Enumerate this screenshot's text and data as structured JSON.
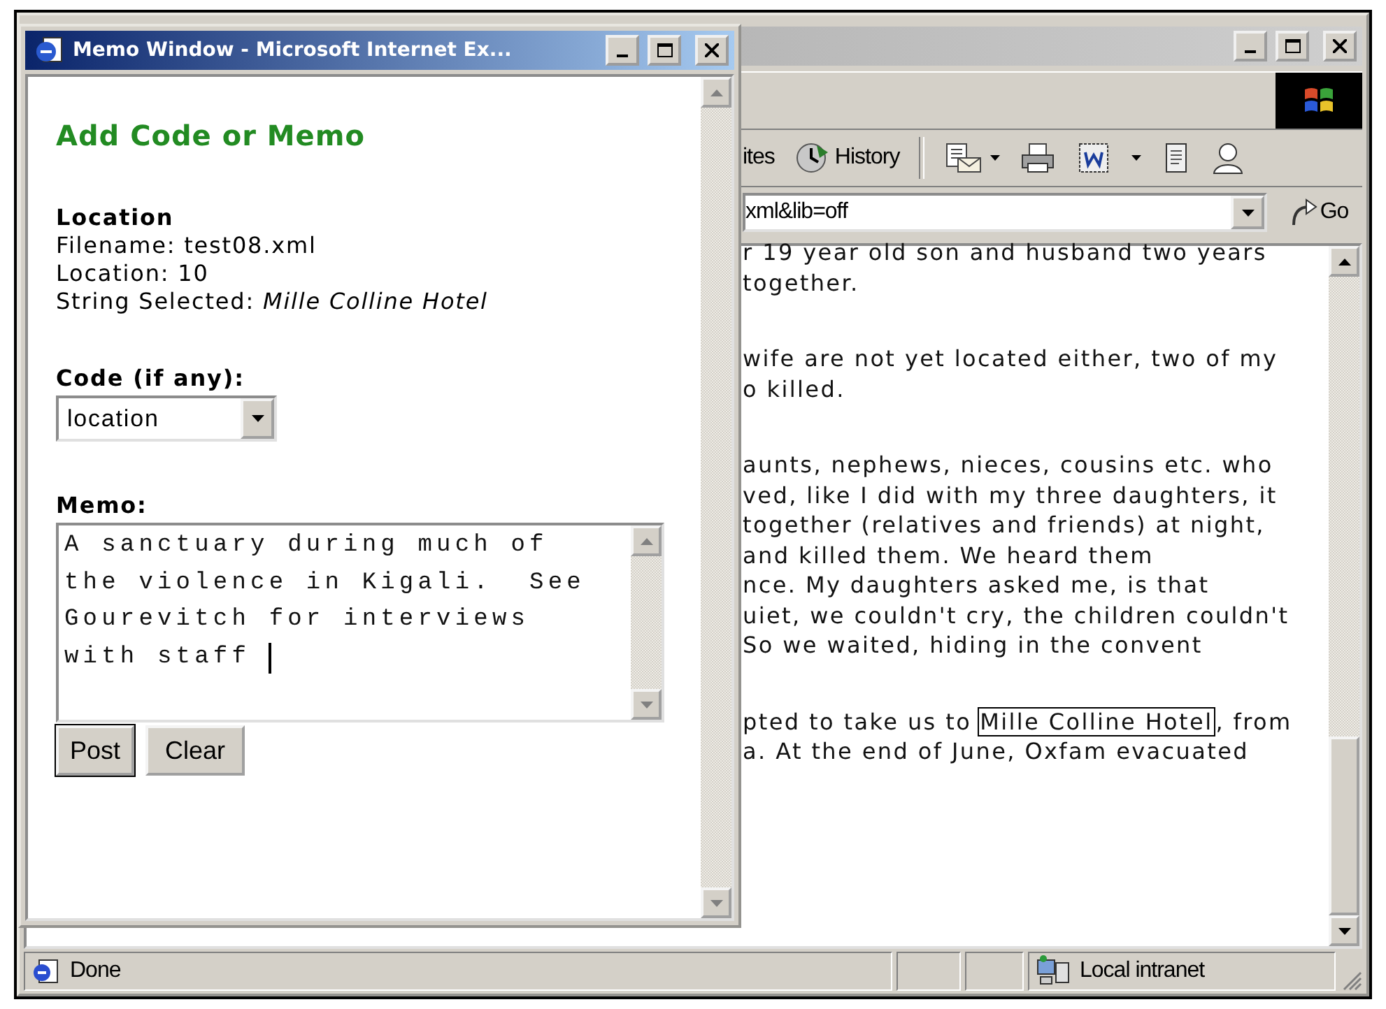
{
  "browser_window": {
    "active": false,
    "toolbar": {
      "buttons": [
        {
          "kind": "text",
          "label": "ites"
        },
        {
          "kind": "history",
          "label": "History"
        },
        {
          "kind": "mail"
        },
        {
          "kind": "print"
        },
        {
          "kind": "edit"
        },
        {
          "kind": "discuss"
        },
        {
          "kind": "messenger"
        }
      ]
    },
    "address_bar": {
      "value": "xml&lib=off",
      "go_label": "Go"
    },
    "document": {
      "paragraphs": [
        {
          "lines": [
            {
              "text": "r 19 year old son and husband two years"
            },
            {
              "text": "together."
            }
          ]
        },
        {
          "lines": [
            {
              "text": "wife are not yet located either, two of my"
            },
            {
              "text": "o killed."
            }
          ]
        },
        {
          "lines": [
            {
              "text": "aunts, nephews, nieces, cousins etc. who"
            },
            {
              "text": "ved, like I did with my three daughters, it"
            },
            {
              "text": "together (relatives and friends) at night,"
            },
            {
              "text": "and killed them. We heard them"
            },
            {
              "text": "nce. My daughters asked me, is that"
            },
            {
              "text": "uiet, we couldn't cry, the children couldn't"
            },
            {
              "text": "So we waited, hiding in the convent"
            }
          ]
        },
        {
          "lines": [
            {
              "text": "pted to take us to",
              "boxed": "Mille Colline Hotel",
              "after": ", from"
            },
            {
              "text": "a. At the end of June, Oxfam evacuated"
            }
          ]
        }
      ]
    },
    "status_bar": {
      "text": "Done",
      "zone": "Local intranet"
    }
  },
  "memo_window": {
    "active": true,
    "title": "Memo Window - Microsoft Internet Ex...",
    "heading": "Add Code or Memo",
    "location": {
      "label": "Location",
      "lines": [
        "Filename: test08.xml",
        "Location: 10",
        "String Selected: *Mille Colline Hotel*"
      ]
    },
    "code": {
      "label": "Code (if any):",
      "value": "location"
    },
    "memo": {
      "label": "Memo:",
      "lines": [
        "A sanctuary during much of",
        "the violence in Kigali.  See",
        "Gourevitch for interviews",
        "with staff "
      ],
      "caret": true
    },
    "buttons": [
      {
        "label": "Post",
        "default": true
      },
      {
        "label": "Clear",
        "default": false
      }
    ]
  }
}
